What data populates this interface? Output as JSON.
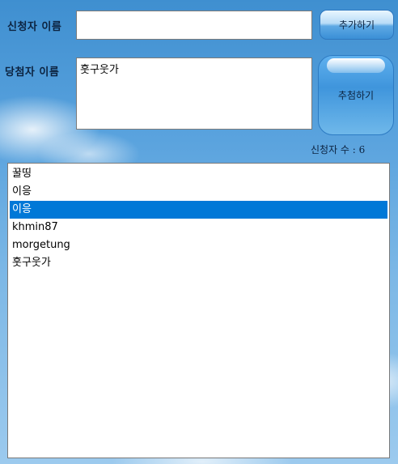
{
  "form": {
    "applicant_label": "신청자 이름",
    "applicant_value": "",
    "winner_label": "당첨자 이름",
    "winner_value": "훗구웃가",
    "add_button": "추가하기",
    "draw_button": "추첨하기",
    "count_text": "신청자 수 : 6"
  },
  "list": {
    "items": [
      "꿀띵",
      "이응",
      "이응",
      "khmin87",
      "morgetung",
      "훗구웃가"
    ],
    "selected_index": 2
  },
  "colors": {
    "selection": "#0078d7",
    "sky_top": "#3f8fd0",
    "sky_bottom": "#9ccaee"
  }
}
